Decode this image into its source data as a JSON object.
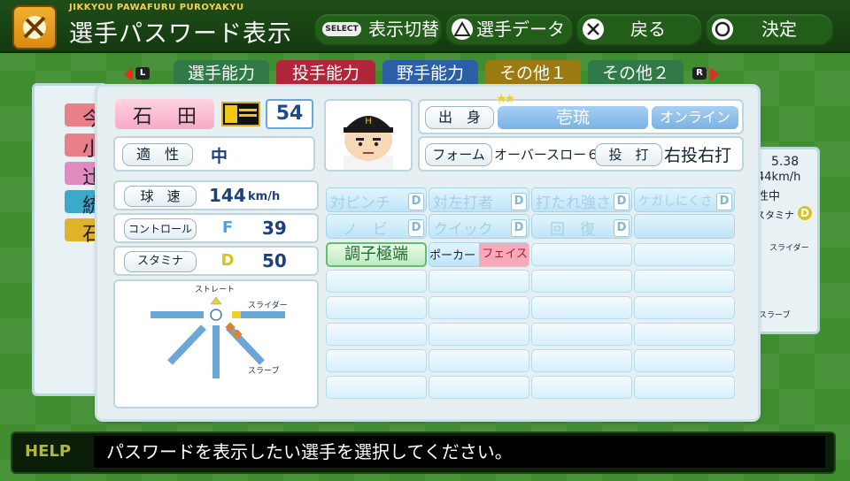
{
  "header": {
    "subtitle": "JIKKYOU PAWAFURU PUROYAKYU",
    "title": "選手パスワード表示",
    "buttons": {
      "select_badge": "SELECT",
      "select_label": "表示切替",
      "triangle_label": "選手データ",
      "cross_label": "戻る",
      "circle_label": "決定"
    }
  },
  "tabs": {
    "l_key": "L",
    "r_key": "R",
    "items": [
      {
        "label": "選手能力",
        "active": true
      },
      {
        "label": "投手能力",
        "active": false
      },
      {
        "label": "野手能力",
        "active": false
      },
      {
        "label": "その他１",
        "active": false
      },
      {
        "label": "その他２",
        "active": false
      }
    ]
  },
  "background_list": {
    "left_chars": [
      "今",
      "小",
      "辻",
      "統",
      "石"
    ],
    "right_values": [
      "5.38",
      "44km/h",
      "性中",
      "スタミナ",
      "D",
      "スライダー",
      "スラーブ"
    ]
  },
  "player": {
    "name_1": "石",
    "name_2": "田",
    "number": "54",
    "aptitude_label": "適　性",
    "aptitude_value": "中",
    "origin_label": "出　身",
    "origin_value": "壱琉",
    "online_label": "オンライン",
    "form_label": "フォーム",
    "form_value": "オーバースロー６",
    "throw_bat_label": "投　打",
    "throw_bat_value": "右投右打",
    "stars": 2
  },
  "stats": {
    "speed_label": "球　速",
    "speed_value": "144",
    "speed_unit": "km/h",
    "control_label": "コントロール",
    "control_grade": "F",
    "control_value": "39",
    "stamina_label": "スタミナ",
    "stamina_grade": "D",
    "stamina_value": "50"
  },
  "pitch_chart": {
    "straight_label": "ストレート",
    "slider_label": "スライダー",
    "slurve_label": "スラーブ",
    "slider_level": 1,
    "slurve_level": 2
  },
  "skills": {
    "row1": [
      {
        "text": "対ピンチ",
        "grade": "D"
      },
      {
        "text": "対左打者",
        "grade": "D"
      },
      {
        "text": "打たれ強さ",
        "grade": "D"
      },
      {
        "text": "ケガしにくさ",
        "grade": "D"
      }
    ],
    "row2": [
      {
        "text": "ノ　ビ",
        "grade": "D"
      },
      {
        "text": "クイック",
        "grade": "D"
      },
      {
        "text": "回　復",
        "grade": "D"
      }
    ],
    "special_1": "調子極端",
    "special_2a": "ポーカー",
    "special_2b": "フェイス"
  },
  "help": {
    "tag": "HELP",
    "text": "パスワードを表示したい選手を選択してください。"
  },
  "colors": {
    "tab_active": "#2f7a46",
    "tab_pitch": "#b3263a",
    "tab_field": "#2b5fa8",
    "tab_other": "#9c7a12",
    "tab_other2": "#2f7a46",
    "grade_F": "#4aa3e8",
    "grade_D": "#d9c21d"
  }
}
